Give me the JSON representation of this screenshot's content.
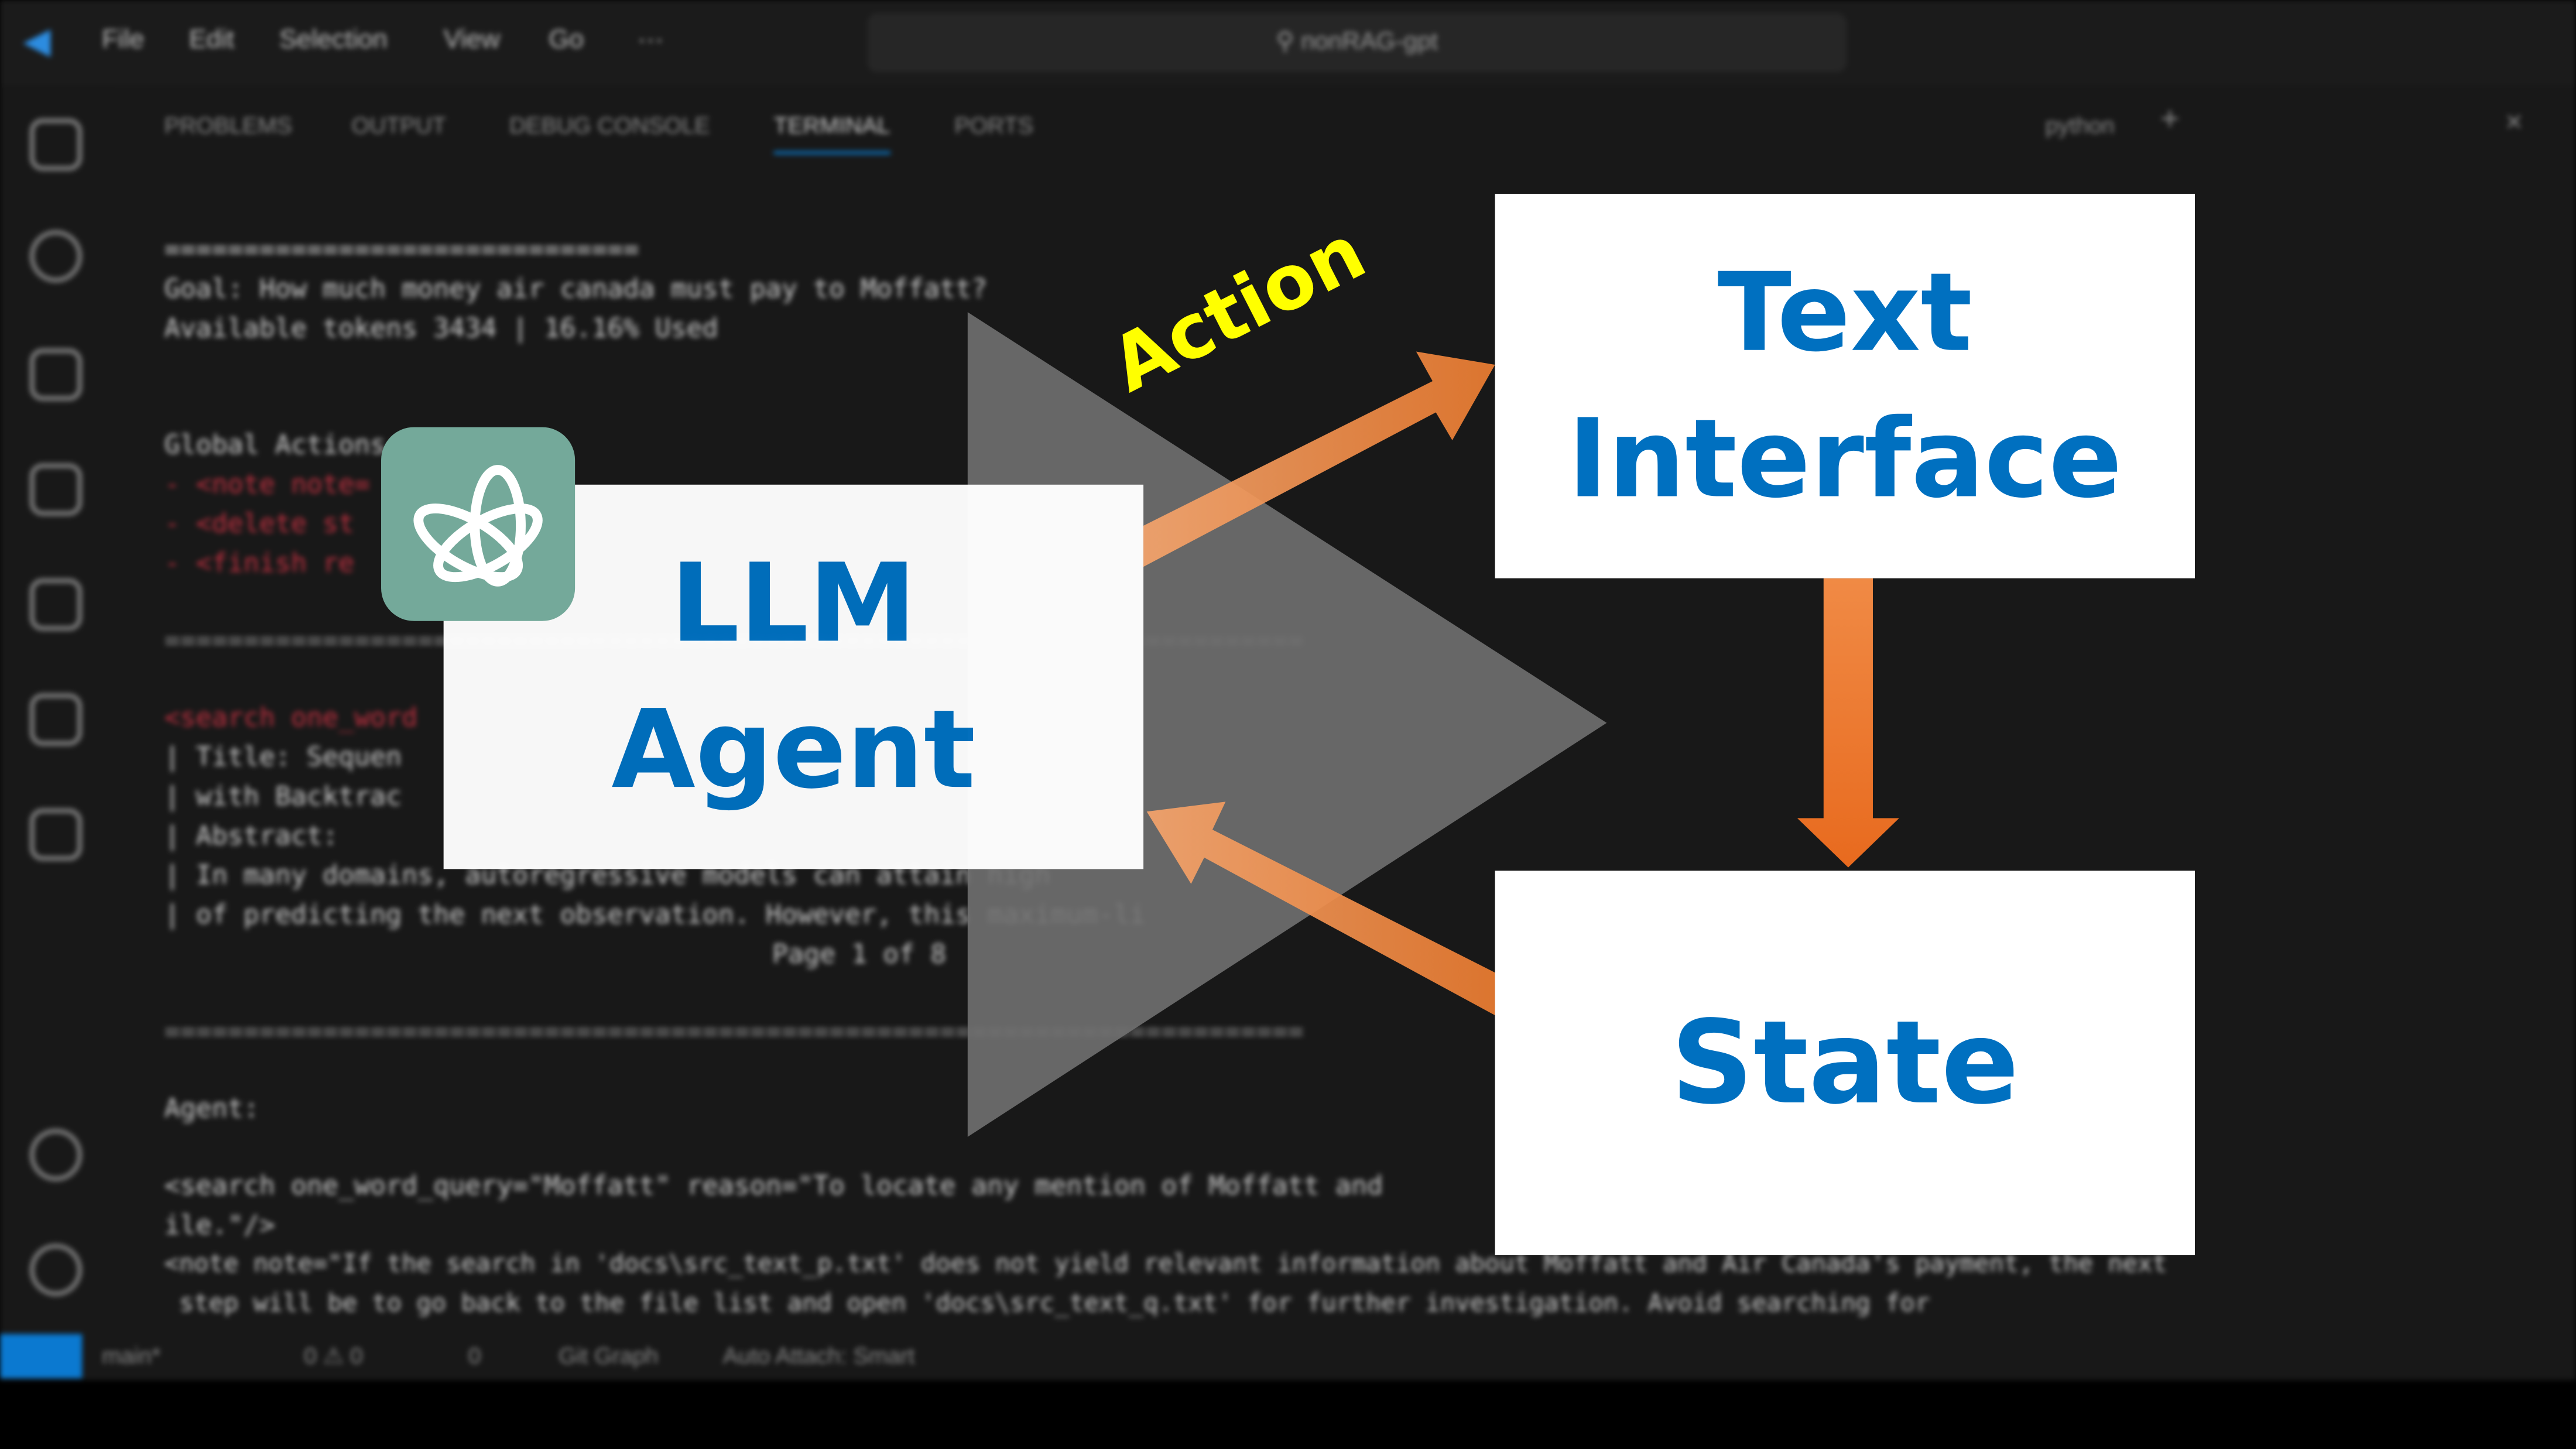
{
  "background": {
    "menu": [
      "File",
      "Edit",
      "Selection",
      "View",
      "Go",
      "···"
    ],
    "search": "nonRAG-gpt",
    "panel_tabs": [
      "PROBLEMS",
      "OUTPUT",
      "DEBUG CONSOLE",
      "TERMINAL",
      "PORTS"
    ],
    "terminal_profile": "python",
    "terminal_lines": [
      "==============================",
      "Goal: How much money air canada must pay to Moffatt?",
      "Available tokens 3434 | 16.16% Used",
      "Global Actions:",
      "- <note note=",
      "- <delete st",
      "- <finish re",
      "<search one_word",
      "| Title: Sequen",
      "| with Backtrac",
      "| Abstract:",
      "| In many domains, autoregressive models can attain high",
      "| of predicting the next observation. However, this maximum-li",
      "Page 1 of 8",
      "Agent:",
      "<search one_word_query=\"Moffatt\" reason=\"To locate any mention of Moffatt and",
      "ile.\"/>",
      "<note note=\"If the search in 'docs\\src_text_p.txt' does not yield relevant information about Moffatt and Air Canada's payment, the next",
      " step will be to go back to the file list and open 'docs\\src_text_q.txt' for further investigation. Avoid searching for"
    ],
    "status": {
      "branch": "main*",
      "problems": "0 ⚠ 0",
      "ports": "0",
      "git_graph": "Git Graph",
      "auto_attach": "Auto Attach: Smart"
    }
  },
  "diagram": {
    "agent_line1": "LLM",
    "agent_line2": "Agent",
    "interface_line1": "Text",
    "interface_line2": "Interface",
    "state": "State",
    "action_label": "Action",
    "colors": {
      "text_blue": "#0070C0",
      "arrow_orange": "#ED7D31",
      "action_yellow": "#FFFF00",
      "logo_green": "#74A99A",
      "triangle_gray": "#6E6E6E"
    },
    "logo_icon": "openai-logo-icon"
  }
}
